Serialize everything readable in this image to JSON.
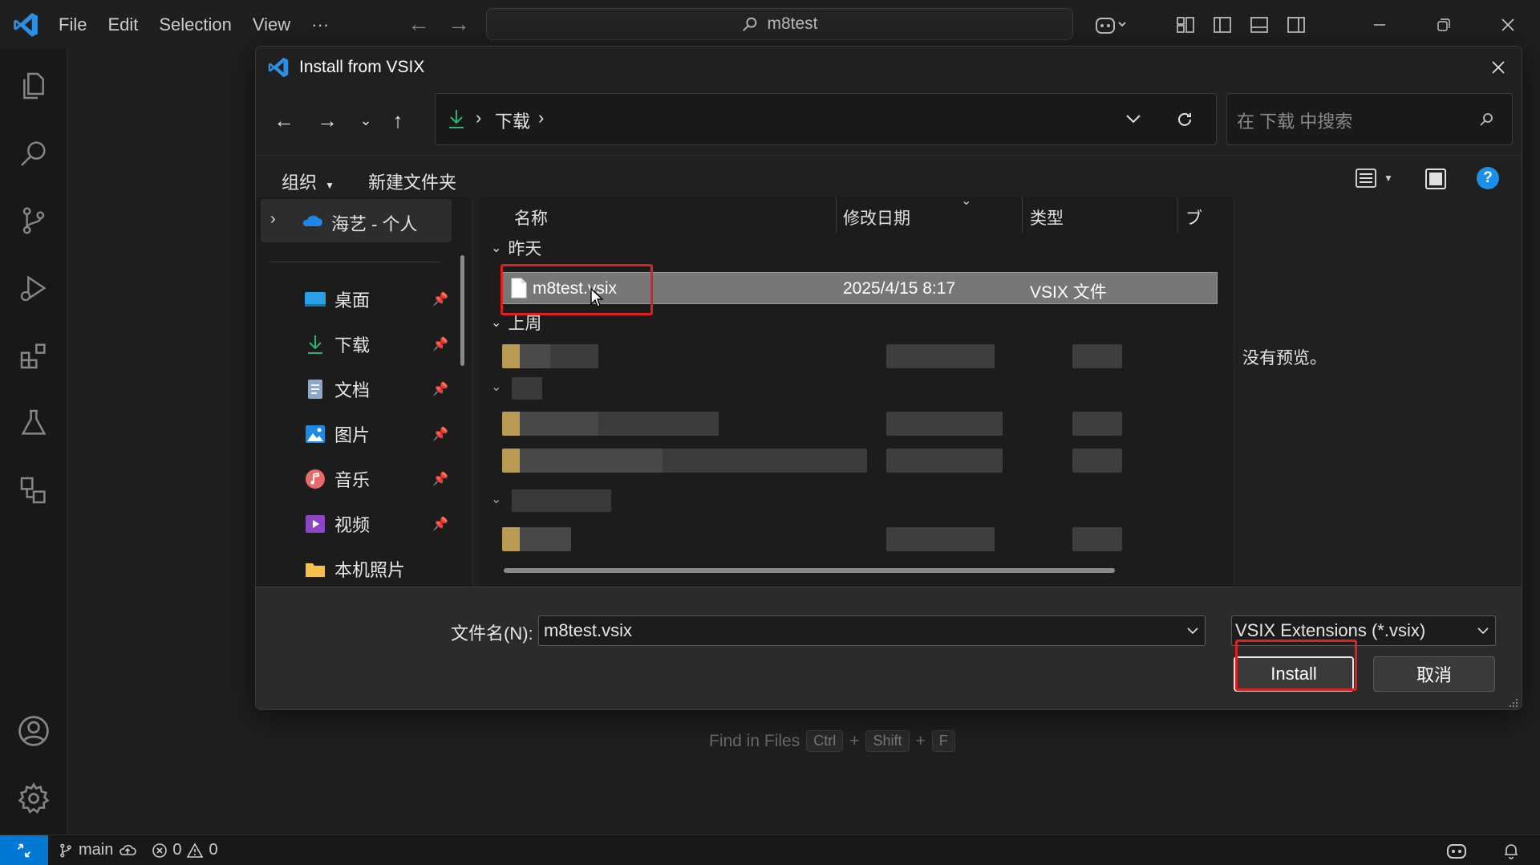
{
  "titlebar": {
    "menu": [
      "File",
      "Edit",
      "Selection",
      "View",
      "···"
    ],
    "search_text": "m8test"
  },
  "dialog": {
    "title": "Install from VSIX",
    "address": {
      "location": "下载",
      "separator": "›"
    },
    "search_placeholder": "在 下载 中搜索",
    "commands": {
      "organize": "组织",
      "new_folder": "新建文件夹"
    },
    "sidebar": {
      "root": "海艺 - 个人",
      "quick_access": [
        {
          "label": "桌面",
          "icon": "desktop-icon",
          "pinned": true
        },
        {
          "label": "下载",
          "icon": "download-icon",
          "pinned": true
        },
        {
          "label": "文档",
          "icon": "document-icon",
          "pinned": true
        },
        {
          "label": "图片",
          "icon": "pictures-icon",
          "pinned": true
        },
        {
          "label": "音乐",
          "icon": "music-icon",
          "pinned": true
        },
        {
          "label": "视频",
          "icon": "videos-icon",
          "pinned": true
        },
        {
          "label": "本机照片",
          "icon": "folder-icon",
          "pinned": false
        }
      ]
    },
    "columns": {
      "name": "名称",
      "modified": "修改日期",
      "type": "类型",
      "size_partial": "ブ"
    },
    "groups": {
      "yesterday": "昨天",
      "last_week": "上周"
    },
    "selected_file": {
      "name": "m8test.vsix",
      "modified": "2025/4/15 8:17",
      "type": "VSIX 文件"
    },
    "preview_text": "没有预览。",
    "footer": {
      "filename_label": "文件名(N):",
      "filename_value": "m8test.vsix",
      "filter_value": "VSIX Extensions (*.vsix)",
      "install_label": "Install",
      "cancel_label": "取消"
    }
  },
  "editor_hint": {
    "label": "Find in Files",
    "keys": [
      "Ctrl",
      "+",
      "Shift",
      "+",
      "F"
    ]
  },
  "statusbar": {
    "branch": "main",
    "errors": "0",
    "warnings": "0"
  },
  "colors": {
    "accent": "#0078d4",
    "highlight_border": "#e02020",
    "selected_row": "#777777"
  }
}
